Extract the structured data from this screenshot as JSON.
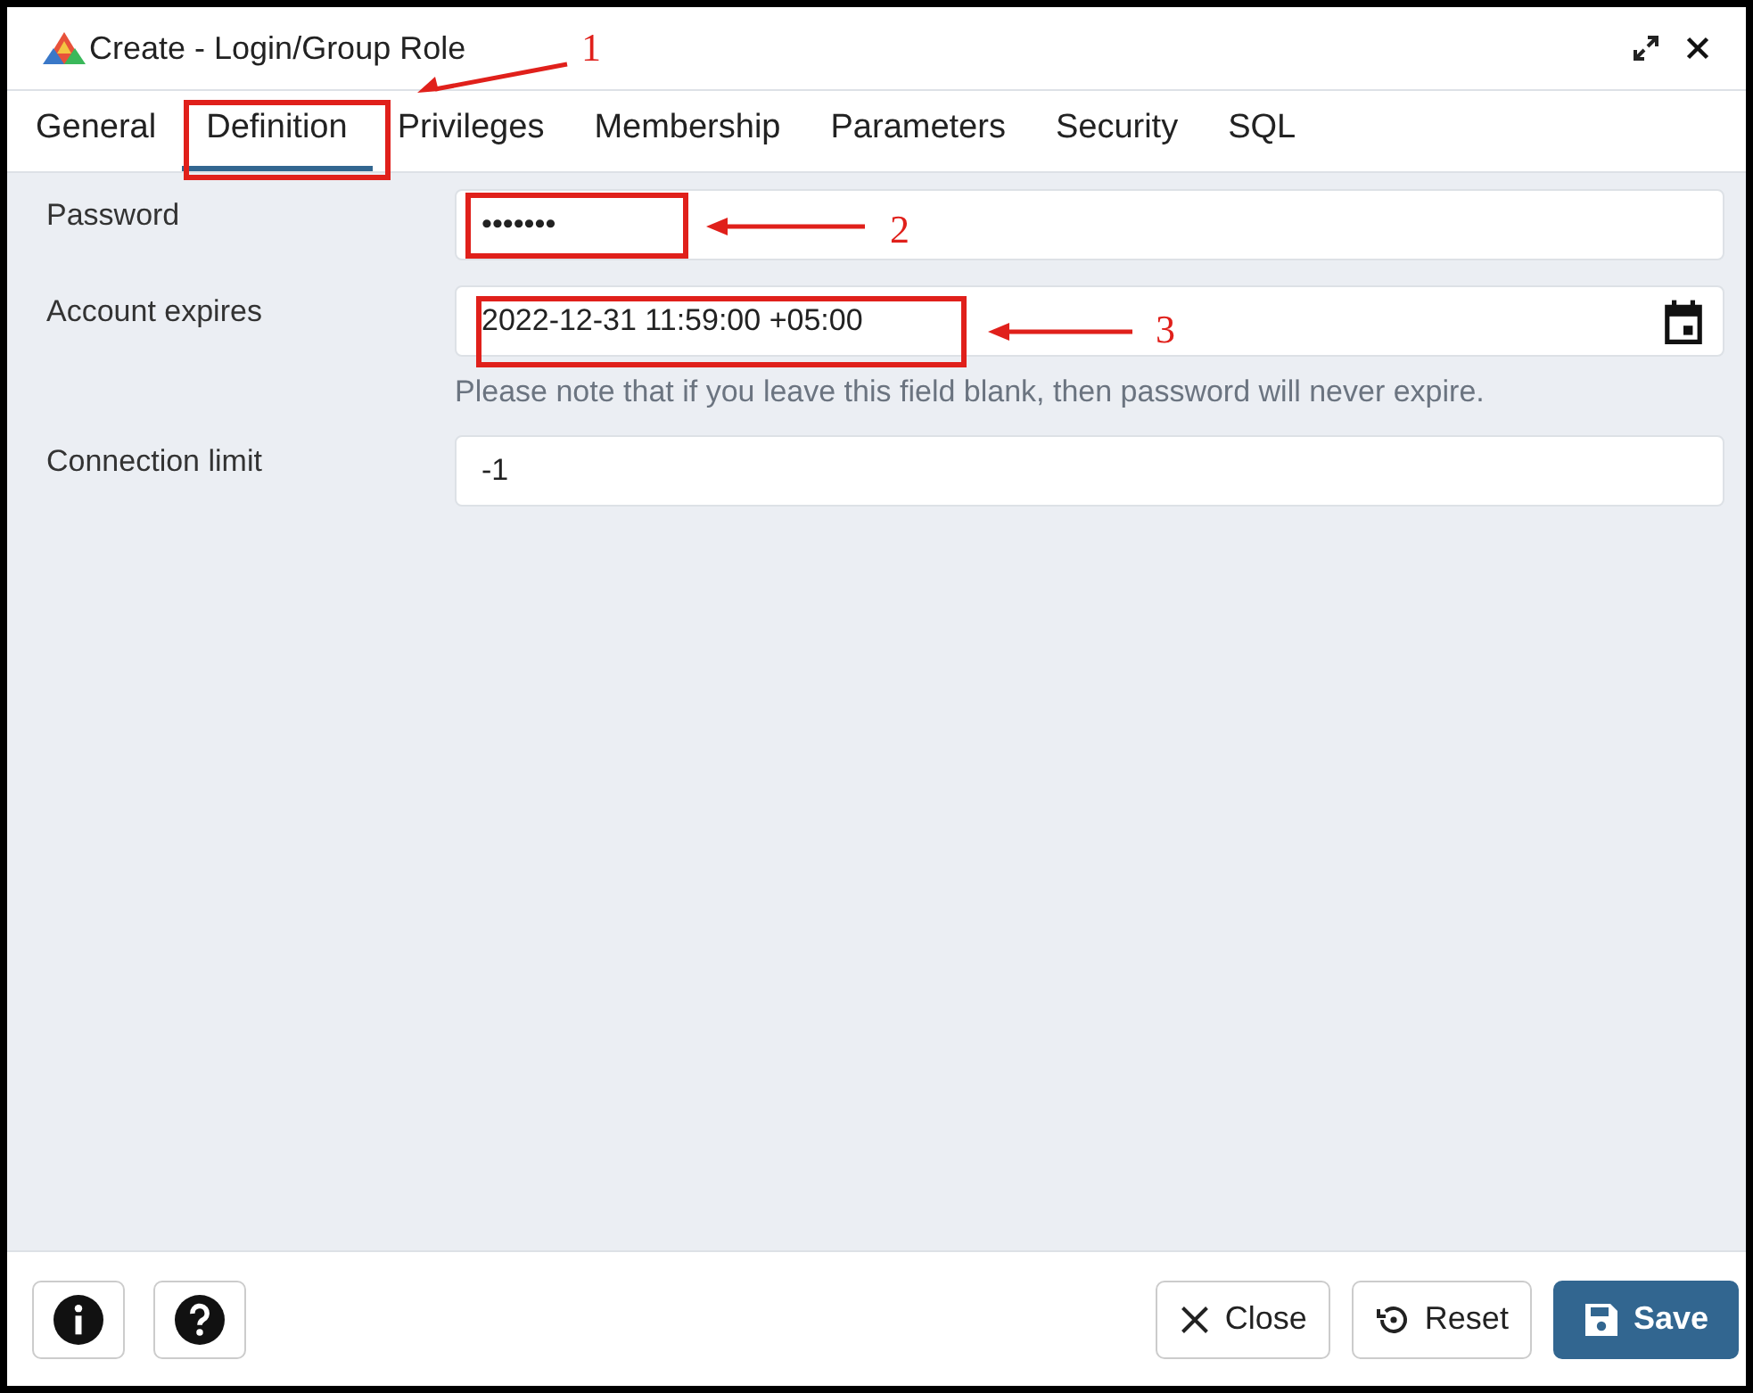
{
  "window": {
    "title": "Create - Login/Group Role"
  },
  "tabs": [
    {
      "label": "General",
      "selected": false
    },
    {
      "label": "Definition",
      "selected": true
    },
    {
      "label": "Privileges",
      "selected": false
    },
    {
      "label": "Membership",
      "selected": false
    },
    {
      "label": "Parameters",
      "selected": false
    },
    {
      "label": "Security",
      "selected": false
    },
    {
      "label": "SQL",
      "selected": false
    }
  ],
  "fields": [
    {
      "kind": "text",
      "label": "Password",
      "value": "•••••••"
    },
    {
      "kind": "date",
      "label": "Account expires",
      "value": "2022-12-31 11:59:00 +05:00",
      "help": "Please note that if you leave this field blank, then password will never expire."
    },
    {
      "kind": "text",
      "label": "Connection limit",
      "value": "-1"
    }
  ],
  "footer": {
    "buttons": [
      {
        "kind": "close",
        "label": "Close"
      },
      {
        "kind": "reset",
        "label": "Reset"
      },
      {
        "kind": "save",
        "label": "Save"
      }
    ]
  },
  "annotations": [
    {
      "label": "1"
    },
    {
      "label": "2"
    },
    {
      "label": "3"
    }
  ]
}
